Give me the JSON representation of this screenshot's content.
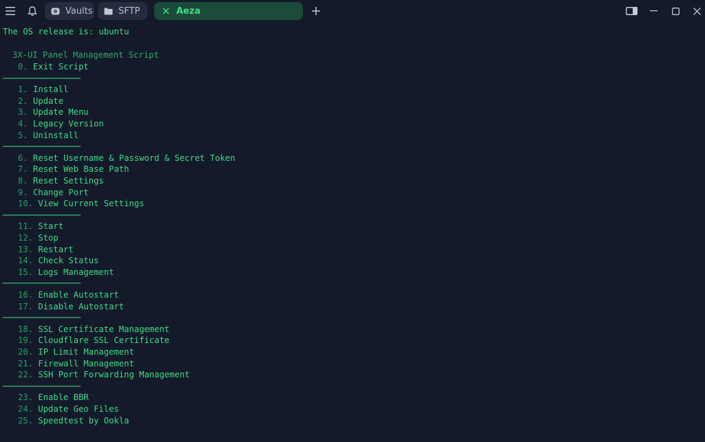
{
  "titlebar": {
    "tabs": [
      {
        "label": "Vaults"
      },
      {
        "label": "SFTP"
      },
      {
        "label": "Aeza"
      }
    ],
    "new_tab_symbol": "+"
  },
  "colors": {
    "background": "#151a2b",
    "terminal_text": "#3ddc84",
    "active_tab_bg": "#1c4a3b",
    "inactive_tab_bg": "#262c3f"
  },
  "terminal": {
    "os_line": "The OS release is: ubuntu",
    "header": "3X-UI Panel Management Script",
    "divider": "────────────────",
    "exit_item": {
      "num": "0.",
      "label": "Exit Script"
    },
    "groups": [
      [
        {
          "num": "1.",
          "label": "Install"
        },
        {
          "num": "2.",
          "label": "Update"
        },
        {
          "num": "3.",
          "label": "Update Menu"
        },
        {
          "num": "4.",
          "label": "Legacy Version"
        },
        {
          "num": "5.",
          "label": "Uninstall"
        }
      ],
      [
        {
          "num": "6.",
          "label": "Reset Username & Password & Secret Token"
        },
        {
          "num": "7.",
          "label": "Reset Web Base Path"
        },
        {
          "num": "8.",
          "label": "Reset Settings"
        },
        {
          "num": "9.",
          "label": "Change Port"
        },
        {
          "num": "10.",
          "label": "View Current Settings"
        }
      ],
      [
        {
          "num": "11.",
          "label": "Start"
        },
        {
          "num": "12.",
          "label": "Stop"
        },
        {
          "num": "13.",
          "label": "Restart"
        },
        {
          "num": "14.",
          "label": "Check Status"
        },
        {
          "num": "15.",
          "label": "Logs Management"
        }
      ],
      [
        {
          "num": "16.",
          "label": "Enable Autostart"
        },
        {
          "num": "17.",
          "label": "Disable Autostart"
        }
      ],
      [
        {
          "num": "18.",
          "label": "SSL Certificate Management"
        },
        {
          "num": "19.",
          "label": "Cloudflare SSL Certificate"
        },
        {
          "num": "20.",
          "label": "IP Limit Management"
        },
        {
          "num": "21.",
          "label": "Firewall Management"
        },
        {
          "num": "22.",
          "label": "SSH Port Forwarding Management"
        }
      ],
      [
        {
          "num": "23.",
          "label": "Enable BBR"
        },
        {
          "num": "24.",
          "label": "Update Geo Files"
        },
        {
          "num": "25.",
          "label": "Speedtest by Ookla"
        }
      ]
    ]
  }
}
